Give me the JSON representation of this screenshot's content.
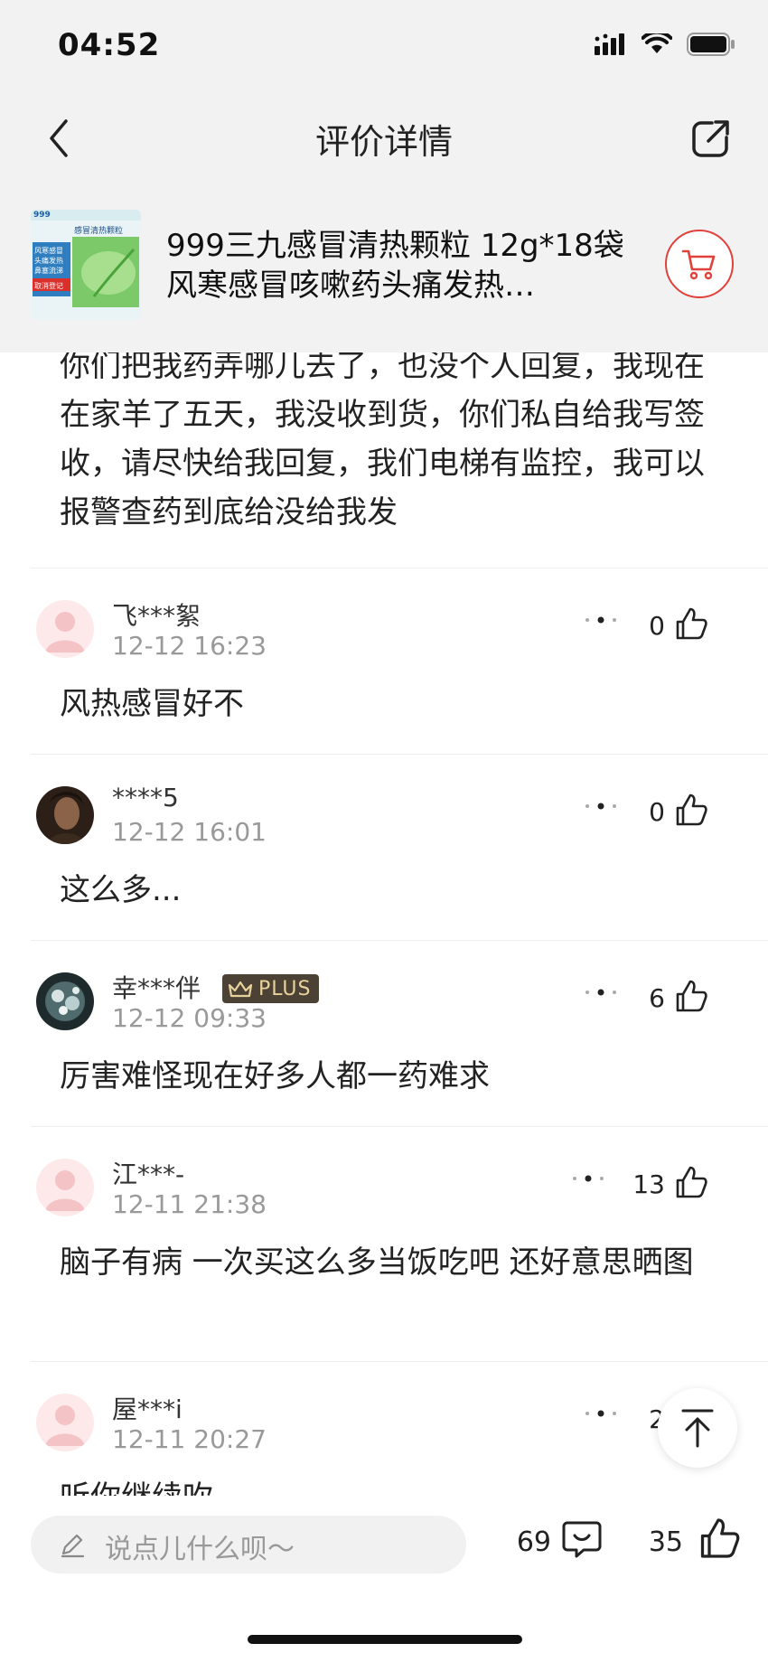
{
  "status_bar": {
    "time": "04:52",
    "icons": [
      "signal-icon",
      "wifi-icon",
      "battery-icon"
    ]
  },
  "nav": {
    "title": "评价详情",
    "back_icon": "back-arrow-icon",
    "share_icon": "share-icon"
  },
  "product": {
    "title": "999三九感冒清热颗粒 12g*18袋风寒感冒咳嗽药头痛发热…",
    "image_alt": "product-image",
    "cart_icon": "shopping-cart-icon",
    "image_text": {
      "brand": "999",
      "name": "感冒清热颗粒",
      "lines": [
        "风寒感冒",
        "头痛发热",
        "鼻塞流涕"
      ],
      "badge": "取消登记"
    }
  },
  "first_comment_text": "你们把我药弄哪儿去了，也没个人回复，我现在在家羊了五天，我没收到货，你们私自给我写签收，请尽快给我回复，我们电梯有监控，我可以报警查药到底给没给我发",
  "comments": [
    {
      "user": "飞***絮",
      "time": "12-12 16:23",
      "likes": "0",
      "text": "风热感冒好不",
      "plus": false,
      "avatar": "default-avatar"
    },
    {
      "user": "****5",
      "time": "12-12 16:01",
      "likes": "0",
      "text": "这么多...",
      "plus": false,
      "avatar": "photo-avatar"
    },
    {
      "user": "幸***伴",
      "time": "12-12 09:33",
      "likes": "6",
      "text": "厉害难怪现在好多人都一药难求",
      "plus": true,
      "plus_label": "PLUS",
      "avatar": "photo-avatar"
    },
    {
      "user": "江***-",
      "time": "12-11 21:38",
      "likes": "13",
      "text": "脑子有病 一次买这么多当饭吃吧 还好意思晒图",
      "plus": false,
      "avatar": "default-avatar"
    },
    {
      "user": "屋***i",
      "time": "12-11 20:27",
      "likes": "2",
      "text": "听你继续吹",
      "plus": false,
      "avatar": "default-avatar"
    }
  ],
  "bottom_bar": {
    "input_placeholder": "说点儿什么呗～",
    "comment_count": "69",
    "like_count": "35"
  },
  "colors": {
    "accent_red": "#e0413a",
    "header_bg": "#f2f2f2",
    "plus_badge_bg": "#4b4235",
    "plus_badge_text": "#e9d19c"
  }
}
